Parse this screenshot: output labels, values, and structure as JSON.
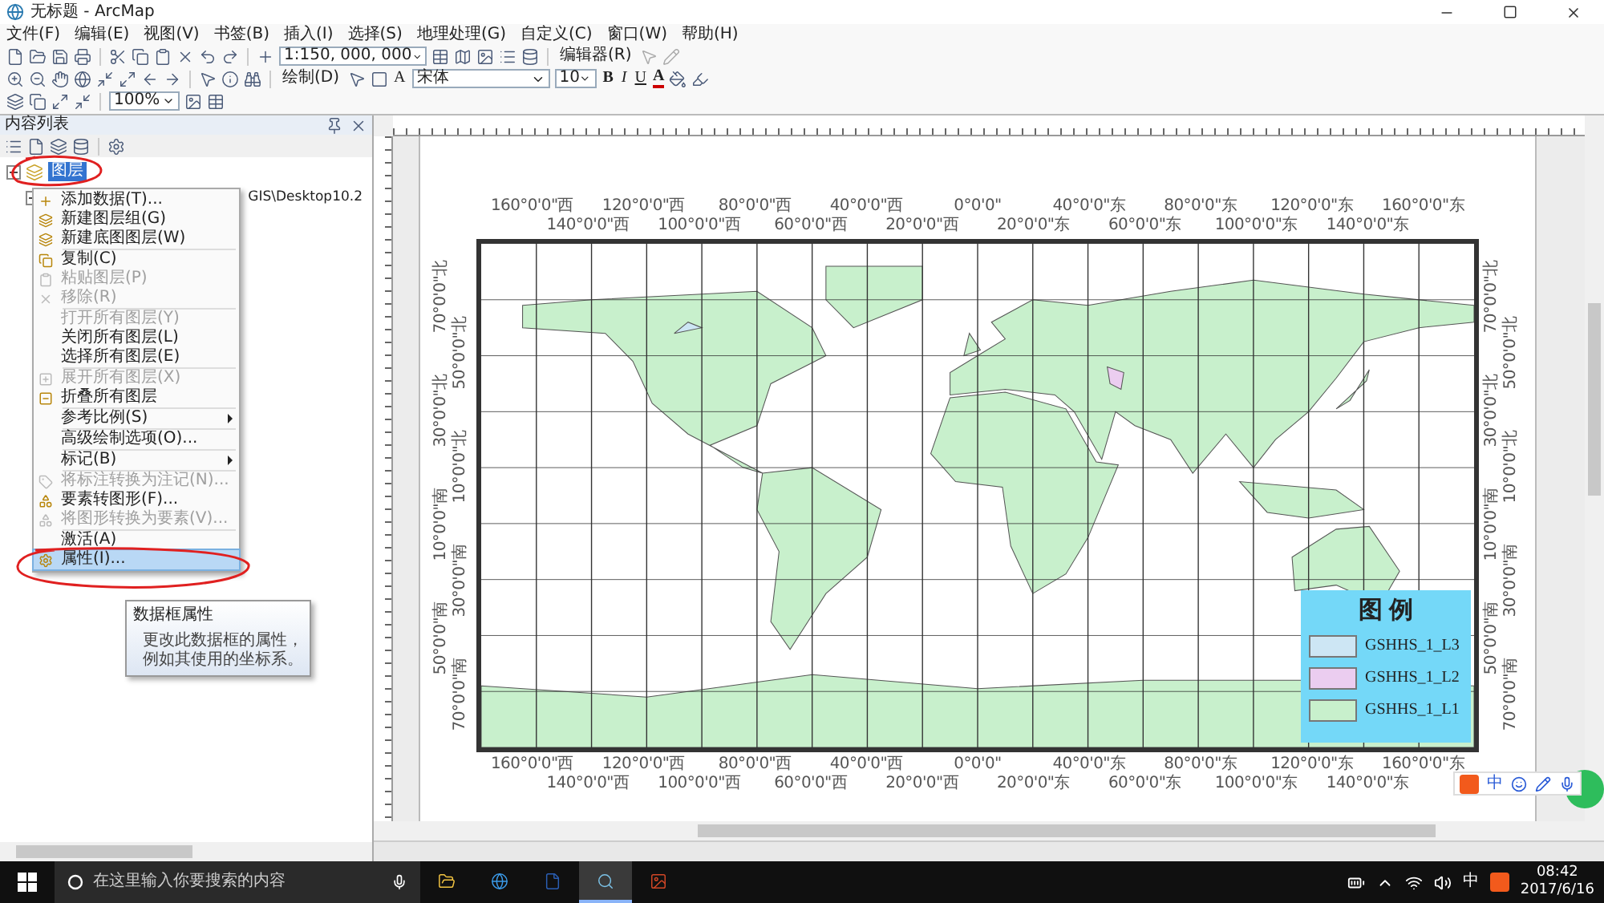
{
  "window": {
    "title": "无标题 - ArcMap"
  },
  "menu_bar": [
    "文件(F)",
    "编辑(E)",
    "视图(V)",
    "书签(B)",
    "插入(I)",
    "选择(S)",
    "地理处理(G)",
    "自定义(C)",
    "窗口(W)",
    "帮助(H)"
  ],
  "toolbars": {
    "scale": "1:150, 000, 000",
    "editor_menu": "编辑器(R)",
    "draw_menu": "绘制(D)",
    "text_tool": "A",
    "font": "宋体",
    "font_size": "10",
    "bold": "B",
    "italic": "I",
    "underline": "U",
    "font_color": "A",
    "zoom": "100%"
  },
  "toc": {
    "title": "内容列表",
    "tree": [
      {
        "label": "图层",
        "selected": true,
        "expanded": true,
        "children": [
          {
            "label": "GIS\\Desktop10.2",
            "selected": false,
            "expanded": true
          }
        ]
      }
    ]
  },
  "context_menu": [
    {
      "kind": "item",
      "label": "添加数据(T)...",
      "disabled": false,
      "submenu": false,
      "selected": false
    },
    {
      "kind": "item",
      "label": "新建图层组(G)",
      "disabled": false,
      "submenu": false,
      "selected": false
    },
    {
      "kind": "item",
      "label": "新建底图图层(W)",
      "disabled": false,
      "submenu": false,
      "selected": false
    },
    {
      "kind": "separator"
    },
    {
      "kind": "item",
      "label": "复制(C)",
      "disabled": false,
      "submenu": false,
      "selected": false
    },
    {
      "kind": "item",
      "label": "粘贴图层(P)",
      "disabled": true,
      "submenu": false,
      "selected": false
    },
    {
      "kind": "item",
      "label": "移除(R)",
      "disabled": true,
      "submenu": false,
      "selected": false
    },
    {
      "kind": "separator"
    },
    {
      "kind": "item",
      "label": "打开所有图层(Y)",
      "disabled": true,
      "submenu": false,
      "selected": false
    },
    {
      "kind": "item",
      "label": "关闭所有图层(L)",
      "disabled": false,
      "submenu": false,
      "selected": false
    },
    {
      "kind": "item",
      "label": "选择所有图层(E)",
      "disabled": false,
      "submenu": false,
      "selected": false
    },
    {
      "kind": "separator"
    },
    {
      "kind": "item",
      "label": "展开所有图层(X)",
      "disabled": true,
      "submenu": false,
      "selected": false
    },
    {
      "kind": "item",
      "label": "折叠所有图层",
      "disabled": false,
      "submenu": false,
      "selected": false
    },
    {
      "kind": "separator"
    },
    {
      "kind": "item",
      "label": "参考比例(S)",
      "disabled": false,
      "submenu": true,
      "selected": false
    },
    {
      "kind": "separator"
    },
    {
      "kind": "item",
      "label": "高级绘制选项(O)...",
      "disabled": false,
      "submenu": false,
      "selected": false
    },
    {
      "kind": "separator"
    },
    {
      "kind": "item",
      "label": "标记(B)",
      "disabled": false,
      "submenu": true,
      "selected": false
    },
    {
      "kind": "separator"
    },
    {
      "kind": "item",
      "label": "将标注转换为注记(N)...",
      "disabled": true,
      "submenu": false,
      "selected": false
    },
    {
      "kind": "item",
      "label": "要素转图形(F)...",
      "disabled": false,
      "submenu": false,
      "selected": false
    },
    {
      "kind": "item",
      "label": "将图形转换为要素(V)...",
      "disabled": true,
      "submenu": false,
      "selected": false
    },
    {
      "kind": "separator"
    },
    {
      "kind": "item",
      "label": "激活(A)",
      "disabled": false,
      "submenu": false,
      "selected": false
    },
    {
      "kind": "item",
      "label": "属性(I)...",
      "disabled": false,
      "submenu": false,
      "selected": true
    }
  ],
  "tooltip": {
    "title": "数据框属性",
    "text": "更改此数据框的属性，例如其使用的坐标系。"
  },
  "map": {
    "top_labels": [
      "160°0'0\"西",
      "140°0'0\"西",
      "120°0'0\"西",
      "100°0'0\"西",
      "80°0'0\"西",
      "60°0'0\"西",
      "40°0'0\"西",
      "20°0'0\"西",
      "0°0'0\"",
      "20°0'0\"东",
      "40°0'0\"东",
      "60°0'0\"东",
      "80°0'0\"东",
      "100°0'0\"东",
      "120°0'0\"东",
      "140°0'0\"东",
      "160°0'0\"东"
    ],
    "bottom_labels": [
      "160°0'0\"西",
      "140°0'0\"西",
      "120°0'0\"西",
      "100°0'0\"西",
      "80°0'0\"西",
      "60°0'0\"西",
      "40°0'0\"西",
      "20°0'0\"西",
      "0°0'0\"",
      "20°0'0\"东",
      "40°0'0\"东",
      "60°0'0\"东",
      "80°0'0\"东",
      "100°0'0\"东",
      "120°0'0\"东",
      "140°0'0\"东",
      "160°0'0\"东"
    ],
    "left_labels": [
      "70°0'0\"北",
      "50°0'0\"北",
      "30°0'0\"北",
      "10°0'0\"北",
      "10°0'0\"南",
      "30°0'0\"南",
      "50°0'0\"南",
      "70°0'0\"南"
    ],
    "right_labels": [
      "70°0'0\"北",
      "50°0'0\"北",
      "30°0'0\"北",
      "10°0'0\"北",
      "10°0'0\"南",
      "30°0'0\"南",
      "50°0'0\"南",
      "70°0'0\"南"
    ],
    "legend": {
      "title": "图 例",
      "items": [
        {
          "label": "GSHHS_1_L3",
          "color": "#cde6f4"
        },
        {
          "label": "GSHHS_1_L2",
          "color": "#ebcdf0"
        },
        {
          "label": "GSHHS_1_L1",
          "color": "#c8f0cc"
        }
      ]
    }
  },
  "ime_bar": {
    "label": "中"
  },
  "taskbar": {
    "search_placeholder": "在这里输入你要搜索的内容",
    "apps": [
      {
        "kind": "folder",
        "selected": false
      },
      {
        "kind": "browser",
        "selected": false
      },
      {
        "kind": "word",
        "selected": false
      },
      {
        "kind": "arcmap",
        "selected": true
      },
      {
        "kind": "powerpoint",
        "selected": false
      }
    ],
    "ime": "中",
    "time": "08:42",
    "date": "2017/6/16"
  }
}
